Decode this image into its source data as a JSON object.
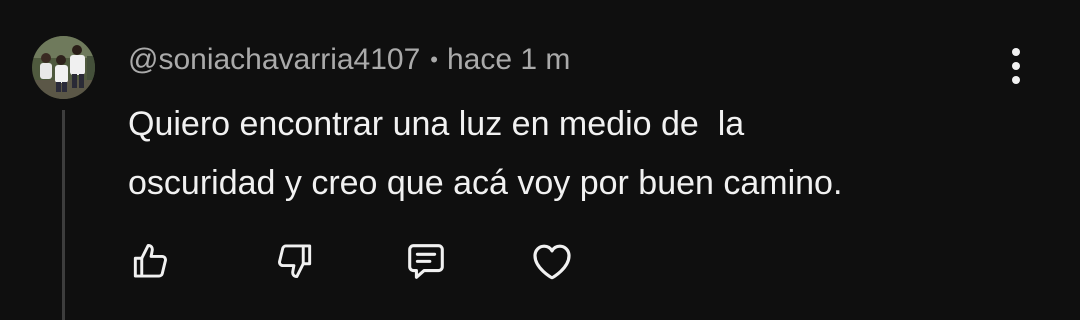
{
  "comment": {
    "author": "@soniachavarria4107",
    "separator": "•",
    "time": "hace 1 m",
    "text": "Quiero encontrar una luz en medio de  la\noscuridad y creo que acá voy por buen camino."
  },
  "icons": {
    "more": "more-vert-icon",
    "like": "thumb-up-icon",
    "dislike": "thumb-down-icon",
    "reply": "reply-comment-icon",
    "heart": "heart-icon"
  },
  "colors": {
    "background": "#0f0f0f",
    "primary_text": "#f1f1f1",
    "secondary_text": "#aaaaaa",
    "thread_line": "#3d3d3d"
  }
}
